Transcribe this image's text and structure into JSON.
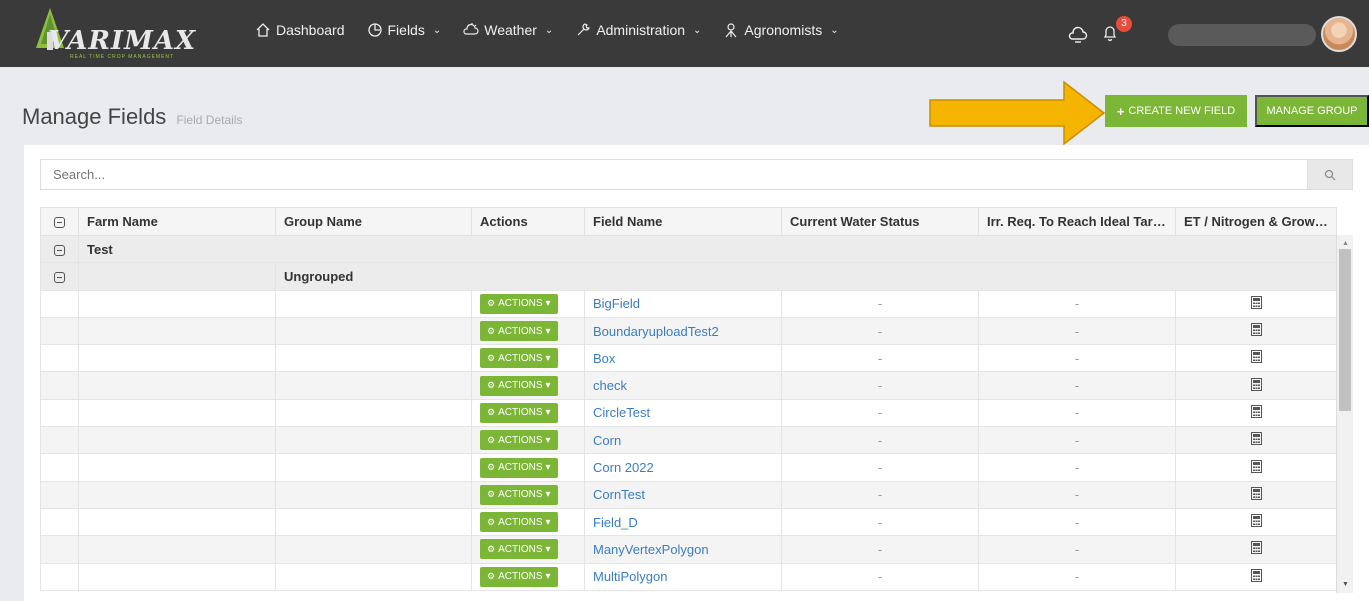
{
  "app": {
    "logo_text": "VARIMAX",
    "logo_subtitle": "REAL TIME CROP MANAGEMENT"
  },
  "nav": {
    "dashboard": "Dashboard",
    "fields": "Fields",
    "weather": "Weather",
    "administration": "Administration",
    "agronomists": "Agronomists"
  },
  "notifications": {
    "count": "3"
  },
  "page": {
    "title": "Manage Fields",
    "subtitle": "Field Details"
  },
  "buttons": {
    "create_new_field": "CREATE NEW FIELD",
    "manage_group": "MANAGE GROUP"
  },
  "search": {
    "placeholder": "Search..."
  },
  "table": {
    "headers": {
      "farm_name": "Farm Name",
      "group_name": "Group Name",
      "actions": "Actions",
      "field_name": "Field Name",
      "water_status": "Current Water Status",
      "irr_req": "Irr. Req. To Reach Ideal Targ...",
      "et_nitrogen": "ET / Nitrogen & Growt..."
    },
    "farm_group": "Test",
    "sub_group": "Ungrouped",
    "actions_label": "ACTIONS",
    "empty_value": "-",
    "rows": [
      {
        "field": "BigField"
      },
      {
        "field": "BoundaryuploadTest2"
      },
      {
        "field": "Box"
      },
      {
        "field": "check"
      },
      {
        "field": "CircleTest"
      },
      {
        "field": "Corn"
      },
      {
        "field": "Corn 2022"
      },
      {
        "field": "CornTest"
      },
      {
        "field": "Field_D"
      },
      {
        "field": "ManyVertexPolygon"
      },
      {
        "field": "MultiPolygon"
      }
    ]
  },
  "colors": {
    "topbar": "#3a3a3a",
    "accent_green": "#7cb636",
    "link_blue": "#3b7dc0",
    "arrow_yellow": "#f5b400",
    "badge_red": "#e74c3c"
  }
}
